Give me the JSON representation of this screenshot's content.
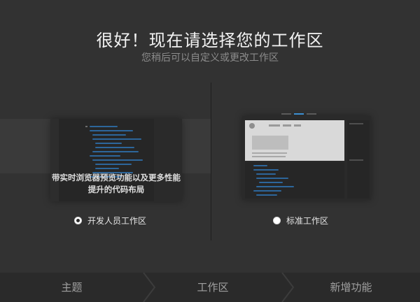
{
  "header": {
    "title": "很好！现在请选择您的工作区",
    "subtitle": "您稍后可以自定义或更改工作区"
  },
  "options": [
    {
      "label": "开发人员工作区",
      "description": "带实时浏览器预览功能以及更多性能提升的代码布局",
      "selected": true
    },
    {
      "label": "标准工作区",
      "selected": false
    }
  ],
  "steps": [
    {
      "label": "主题"
    },
    {
      "label": "工作区",
      "active": true
    },
    {
      "label": "新增功能"
    }
  ],
  "colors": {
    "background": "#323232",
    "code_accent": "#2f6ea8",
    "tab_active": "#3b8fd2"
  }
}
